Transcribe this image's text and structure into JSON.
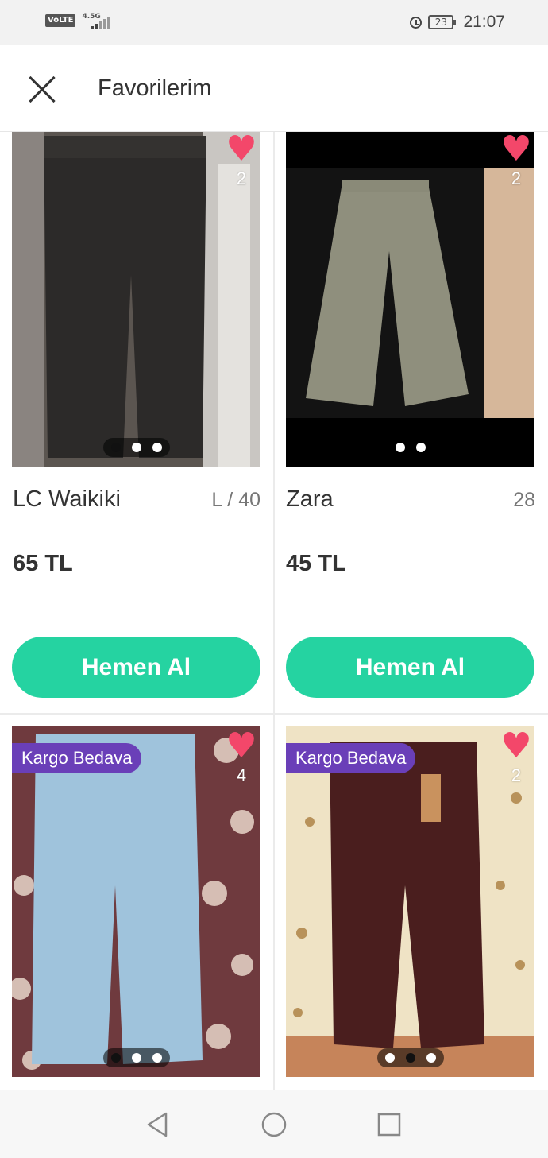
{
  "status_bar": {
    "network_badge": "VoLTE",
    "network_type": "4.5G",
    "battery": "23",
    "time": "21:07"
  },
  "header": {
    "title": "Favorilerim"
  },
  "products": [
    {
      "brand": "LC Waikiki",
      "size": "L / 40",
      "price": "65 TL",
      "favorites": "2",
      "buy_label": "Hemen Al"
    },
    {
      "brand": "Zara",
      "size": "28",
      "price": "45 TL",
      "favorites": "2",
      "buy_label": "Hemen Al"
    },
    {
      "badge": "Kargo Bedava",
      "favorites": "4"
    },
    {
      "badge": "Kargo Bedava",
      "favorites": "2"
    }
  ],
  "colors": {
    "accent": "#25d3a1",
    "heart": "#f3476a",
    "badge": "#6a3fb8"
  }
}
